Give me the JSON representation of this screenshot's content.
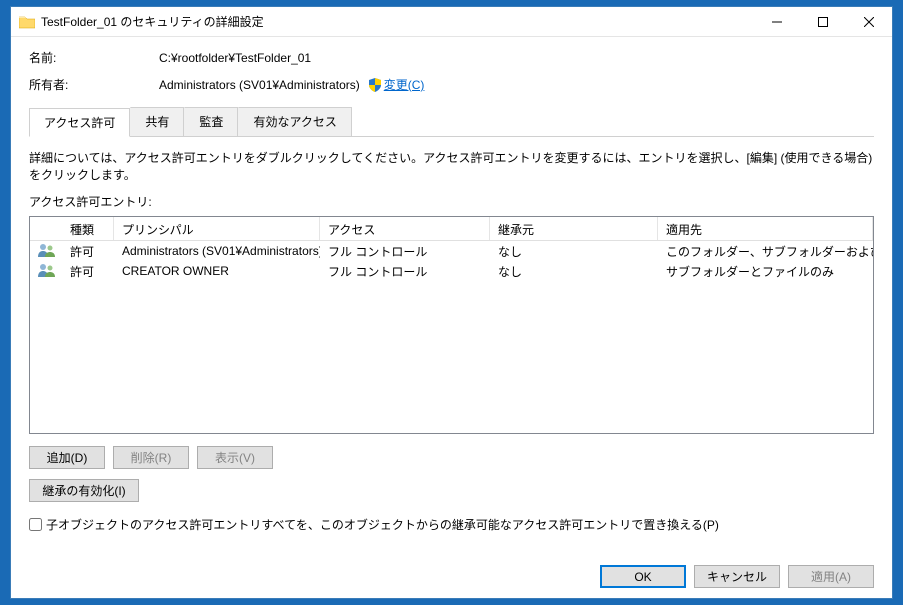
{
  "window": {
    "title": "TestFolder_01 のセキュリティの詳細設定"
  },
  "win_btns": {
    "min": "—",
    "max": "☐",
    "close": "✕"
  },
  "info": {
    "name_label": "名前:",
    "name_value": "C:¥rootfolder¥TestFolder_01",
    "owner_label": "所有者:",
    "owner_value": "Administrators (SV01¥Administrators)",
    "change_link": "変更(C)"
  },
  "tabs": {
    "permissions": "アクセス許可",
    "share": "共有",
    "auditing": "監査",
    "effective": "有効なアクセス"
  },
  "instructions": "詳細については、アクセス許可エントリをダブルクリックしてください。アクセス許可エントリを変更するには、エントリを選択し、[編集] (使用できる場合) をクリックします。",
  "entries_label": "アクセス許可エントリ:",
  "columns": {
    "type": "種類",
    "principal": "プリンシパル",
    "access": "アクセス",
    "inherited": "継承元",
    "applies": "適用先"
  },
  "rows": [
    {
      "type": "許可",
      "principal": "Administrators (SV01¥Administrators)",
      "access": "フル コントロール",
      "inherited": "なし",
      "applies": "このフォルダー、サブフォルダーおよびファイル"
    },
    {
      "type": "許可",
      "principal": "CREATOR OWNER",
      "access": "フル コントロール",
      "inherited": "なし",
      "applies": "サブフォルダーとファイルのみ"
    }
  ],
  "buttons": {
    "add": "追加(D)",
    "remove": "削除(R)",
    "view": "表示(V)",
    "enable_inherit": "継承の有効化(I)",
    "replace_child": "子オブジェクトのアクセス許可エントリすべてを、このオブジェクトからの継承可能なアクセス許可エントリで置き換える(P)",
    "ok": "OK",
    "cancel": "キャンセル",
    "apply": "適用(A)"
  }
}
